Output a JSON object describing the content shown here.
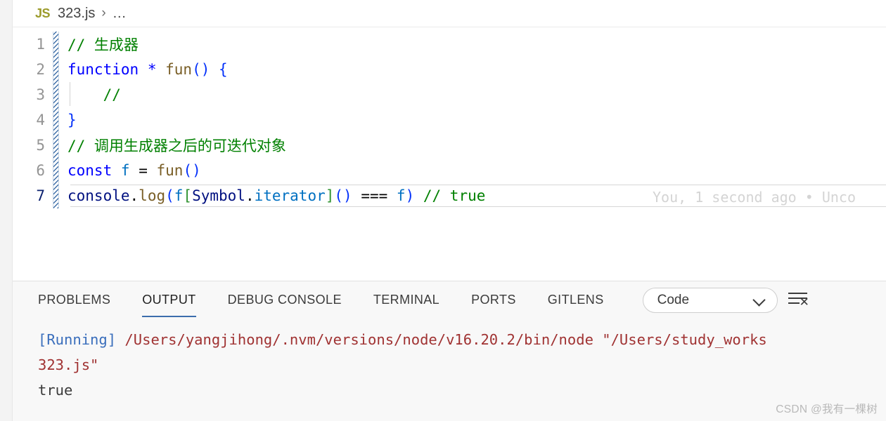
{
  "breadcrumb": {
    "file_icon_label": "JS",
    "file_name": "323.js",
    "separator": "›",
    "more": "…"
  },
  "editor": {
    "lines": [
      {
        "num": "1",
        "text": "// 生成器"
      },
      {
        "num": "2",
        "text": "function * fun() {"
      },
      {
        "num": "3",
        "text": "    //"
      },
      {
        "num": "4",
        "text": "}"
      },
      {
        "num": "5",
        "text": "// 调用生成器之后的可迭代对象"
      },
      {
        "num": "6",
        "text": "const f = fun()"
      },
      {
        "num": "7",
        "text": "console.log(f[Symbol.iterator]() === f) // true"
      }
    ],
    "tokens": {
      "l1_comment": "// 生成器",
      "l2_keyword": "function",
      "l2_star": "*",
      "l2_fn": "fun",
      "l2_parens": "()",
      "l2_brace": "{",
      "l3_comment": "//",
      "l4_brace": "}",
      "l5_comment": "// 调用生成器之后的可迭代对象",
      "l6_keyword": "const",
      "l6_var": "f",
      "l6_eq": "=",
      "l6_fn": "fun",
      "l6_parens": "()",
      "l7_obj": "console",
      "l7_dot": ".",
      "l7_method": "log",
      "l7_lparen": "(",
      "l7_var1": "f",
      "l7_lbracket": "[",
      "l7_symbol": "Symbol",
      "l7_dot2": ".",
      "l7_iterator": "iterator",
      "l7_rbracket": "]",
      "l7_call": "()",
      "l7_eqeqeq": " === ",
      "l7_var2": "f",
      "l7_rparen": ")",
      "l7_comment": " // true"
    },
    "blame": "You, 1 second ago • Unco"
  },
  "panel": {
    "tabs": [
      {
        "label": "PROBLEMS",
        "active": false
      },
      {
        "label": "OUTPUT",
        "active": true
      },
      {
        "label": "DEBUG CONSOLE",
        "active": false
      },
      {
        "label": "TERMINAL",
        "active": false
      },
      {
        "label": "PORTS",
        "active": false
      },
      {
        "label": "GITLENS",
        "active": false
      }
    ],
    "channel_select": {
      "value": "Code"
    },
    "clear_x": "✕",
    "output": {
      "running_label": "[Running]",
      "command_line1": " /Users/yangjihong/.nvm/versions/node/v16.20.2/bin/node \"/Users/study_works",
      "command_line2": "323.js\"",
      "result": "true"
    }
  },
  "watermark": "CSDN @我有一棵树",
  "colors": {
    "accent": "#3c6ead",
    "comment": "#008000",
    "keyword": "#0000ff",
    "function": "#795e26",
    "variable": "#0070c1",
    "object": "#001080",
    "bracket_blue": "#0431fa",
    "bracket_green": "#319331",
    "output_running": "#3a6ebc",
    "output_path": "#a03232",
    "js_icon": "#9c9b2b"
  }
}
